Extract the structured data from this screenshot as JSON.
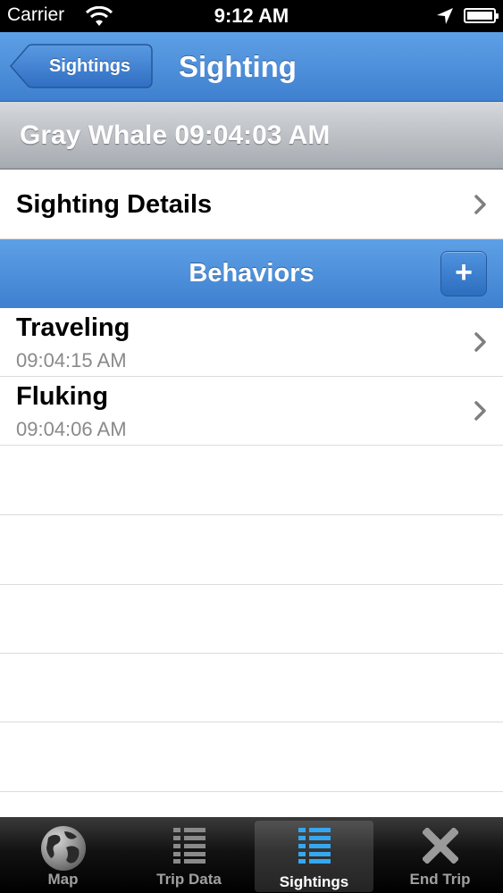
{
  "status_bar": {
    "carrier": "Carrier",
    "time": "9:12 AM"
  },
  "nav": {
    "back_label": "Sightings",
    "title": "Sighting"
  },
  "sighting_header": "Gray Whale 09:04:03 AM",
  "details_row": {
    "label": "Sighting Details"
  },
  "behaviors": {
    "title": "Behaviors",
    "add_label": "+",
    "items": [
      {
        "name": "Traveling",
        "time": "09:04:15 AM"
      },
      {
        "name": "Fluking",
        "time": "09:04:06 AM"
      }
    ]
  },
  "tabs": [
    {
      "label": "Map",
      "icon": "globe-icon"
    },
    {
      "label": "Trip Data",
      "icon": "list-icon"
    },
    {
      "label": "Sightings",
      "icon": "list-icon",
      "selected": true
    },
    {
      "label": "End Trip",
      "icon": "x-icon"
    }
  ],
  "colors": {
    "accent_blue": "#4a8fdc",
    "selected_tab_icon": "#35a7f0"
  }
}
